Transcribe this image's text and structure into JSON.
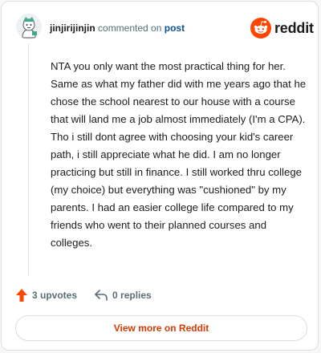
{
  "comment": {
    "username": "jinjirijinjin",
    "action_text": "commented on",
    "post_link": "post",
    "body": "NTA you only want the most practical thing for her. Same as what my father did with me years ago that he chose the school nearest to our house with a course that will land me a job almost immediately (I'm a CPA). Tho i still dont agree with choosing your kid's career path, i still appreciate what he did. I am no longer practicing but still in finance. I still worked thru college (my choice) but everything was \"cushioned\" by my parents. I had an easier college life compared to my friends who went to their planned courses and colleges."
  },
  "brand": {
    "name": "reddit",
    "color": "#ff4500"
  },
  "footer": {
    "upvotes": "3 upvotes",
    "replies": "0 replies",
    "view_more": "View more on Reddit"
  },
  "colors": {
    "accent": "#d93900",
    "link": "#0a4f9a",
    "muted": "#576f76"
  },
  "icons": {
    "upvote": "upvote-arrow-icon",
    "reply": "reply-arrow-icon",
    "logo": "reddit-snoo-icon"
  }
}
